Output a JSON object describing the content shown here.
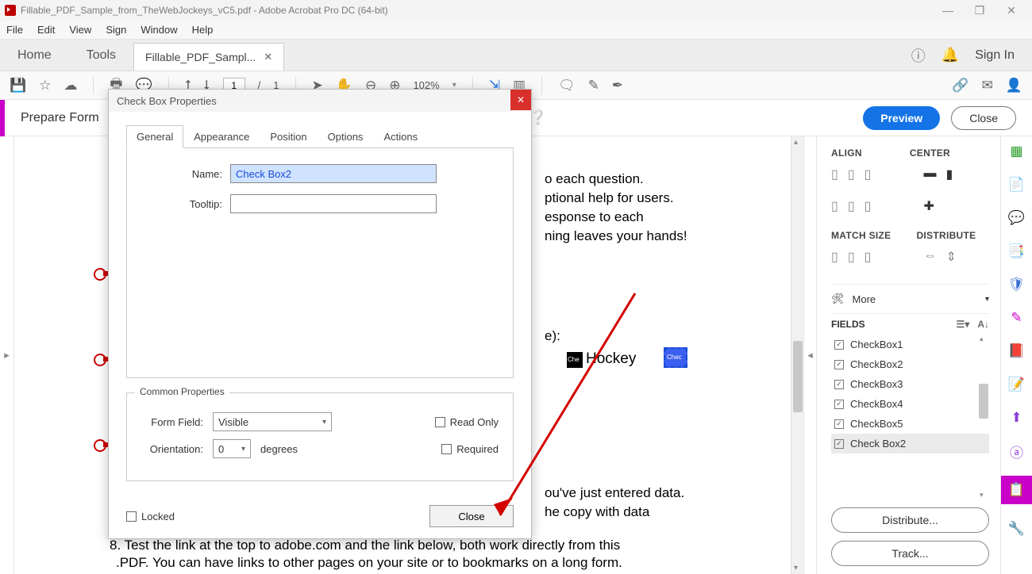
{
  "window": {
    "title": "Fillable_PDF_Sample_from_TheWebJockeys_vC5.pdf - Adobe Acrobat Pro DC (64-bit)"
  },
  "menu": {
    "file": "File",
    "edit": "Edit",
    "view": "View",
    "sign": "Sign",
    "window": "Window",
    "help": "Help"
  },
  "tabs": {
    "home": "Home",
    "tools": "Tools",
    "doc": "Fillable_PDF_Sampl..."
  },
  "header_right": {
    "signin": "Sign In"
  },
  "toolbar": {
    "page_current": "1",
    "page_sep": "/",
    "page_total": "1",
    "zoom": "102%"
  },
  "prepare": {
    "label": "Prepare Form",
    "preview": "Preview",
    "close": "Close"
  },
  "doc": {
    "line1": "o each question.",
    "line2": "ptional help for users.",
    "line3": "esponse to each",
    "line4": "ning leaves your hands!",
    "line5": "e):",
    "hockey_chk": "Che",
    "hockey": "Hockey",
    "sel_chk": "Chec",
    "line6": "ou've just entered data.",
    "line7": "he copy with data",
    "line8": "8. Test the link at the top to adobe.com and the link below, both work directly from this",
    "line9": ".PDF. You can have links to other pages on your site or to bookmarks on a long form."
  },
  "rightpanel": {
    "align": "ALIGN",
    "center": "CENTER",
    "match": "MATCH SIZE",
    "dist": "DISTRIBUTE",
    "more": "More",
    "fields": "FIELDS",
    "items": [
      "CheckBox1",
      "CheckBox2",
      "CheckBox3",
      "CheckBox4",
      "CheckBox5",
      "Check Box2"
    ],
    "distribute": "Distribute...",
    "track": "Track..."
  },
  "dialog": {
    "title": "Check Box Properties",
    "tabs": {
      "general": "General",
      "appearance": "Appearance",
      "position": "Position",
      "options": "Options",
      "actions": "Actions"
    },
    "name_label": "Name:",
    "name_value": "Check Box2",
    "tooltip_label": "Tooltip:",
    "tooltip_value": "",
    "common": "Common Properties",
    "form_field_label": "Form Field:",
    "form_field_value": "Visible",
    "orientation_label": "Orientation:",
    "orientation_value": "0",
    "degrees": "degrees",
    "readonly": "Read Only",
    "required": "Required",
    "locked": "Locked",
    "close": "Close"
  }
}
